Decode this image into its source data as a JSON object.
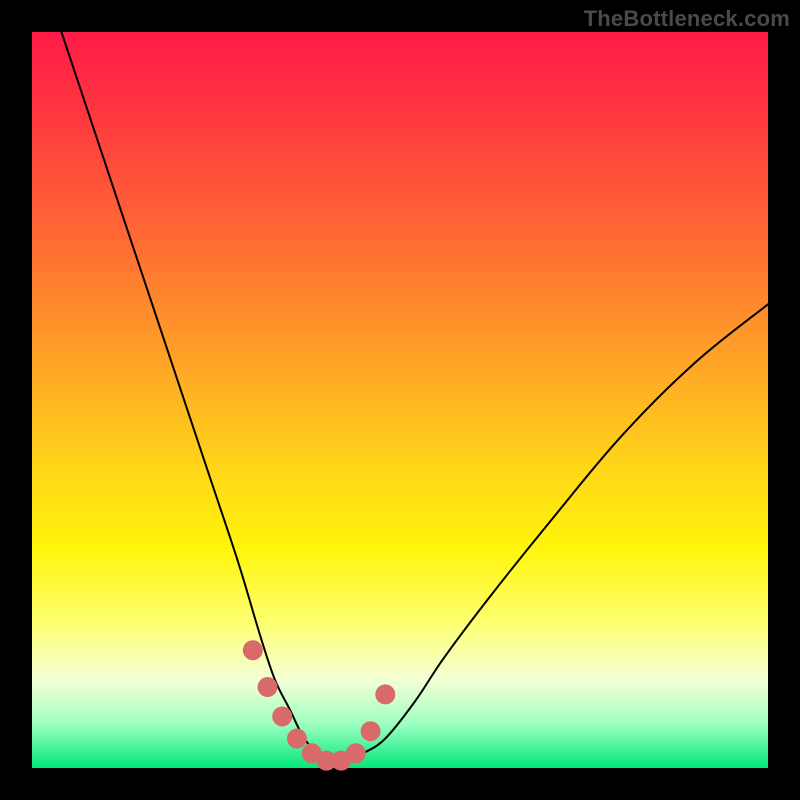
{
  "watermark": "TheBottleneck.com",
  "colors": {
    "curve_stroke": "#000000",
    "marker_fill": "#d96a6a",
    "marker_stroke": "#cf5a5a"
  },
  "chart_data": {
    "type": "line",
    "title": "",
    "xlabel": "",
    "ylabel": "",
    "xlim": [
      0,
      100
    ],
    "ylim": [
      0,
      100
    ],
    "series": [
      {
        "name": "bottleneck-curve",
        "x": [
          4,
          8,
          12,
          16,
          20,
          24,
          28,
          31,
          33,
          35,
          37,
          39,
          41,
          43,
          45,
          48,
          52,
          56,
          62,
          70,
          80,
          90,
          100
        ],
        "y": [
          100,
          88,
          76,
          64,
          52,
          40,
          28,
          18,
          12,
          8,
          4,
          2,
          1,
          1,
          2,
          4,
          9,
          15,
          23,
          33,
          45,
          55,
          63
        ]
      }
    ],
    "markers": {
      "name": "highlight-dots",
      "x": [
        30,
        32,
        34,
        36,
        38,
        40,
        42,
        44,
        46,
        48
      ],
      "y": [
        16,
        11,
        7,
        4,
        2,
        1,
        1,
        2,
        5,
        10
      ]
    }
  }
}
